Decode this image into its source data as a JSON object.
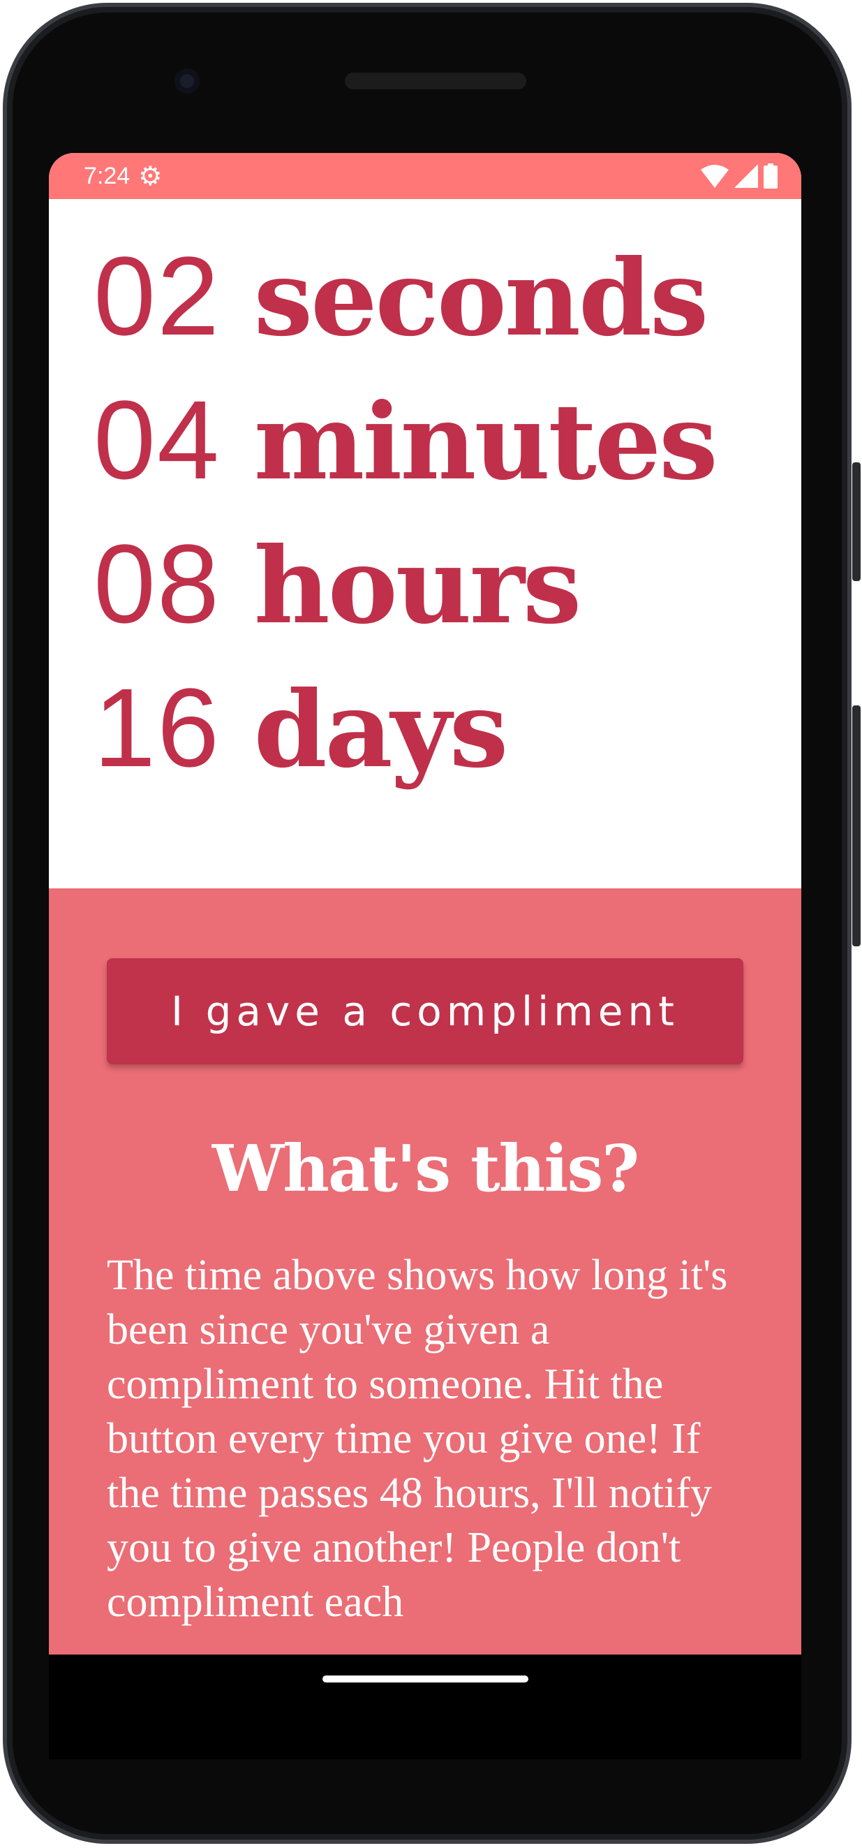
{
  "status_bar": {
    "time": "7:24",
    "settings_icon": "gear-android-icon",
    "wifi_icon": "wifi-icon",
    "signal_icon": "signal-icon",
    "battery_icon": "battery-icon"
  },
  "timer": [
    {
      "value": "02",
      "unit": "seconds"
    },
    {
      "value": "04",
      "unit": "minutes"
    },
    {
      "value": "08",
      "unit": "hours"
    },
    {
      "value": "16",
      "unit": "days"
    }
  ],
  "button": {
    "label": "I gave a compliment"
  },
  "info": {
    "heading": "What's this?",
    "body": "The time above shows how long it's been since you've given a compliment to someone. Hit the button every time you give one! If the time passes 48 hours, I'll notify you to give another! People don't compliment each"
  },
  "colors": {
    "status_bar": "#ff7777",
    "accent": "#c0304a",
    "panel": "#eb6d75"
  }
}
